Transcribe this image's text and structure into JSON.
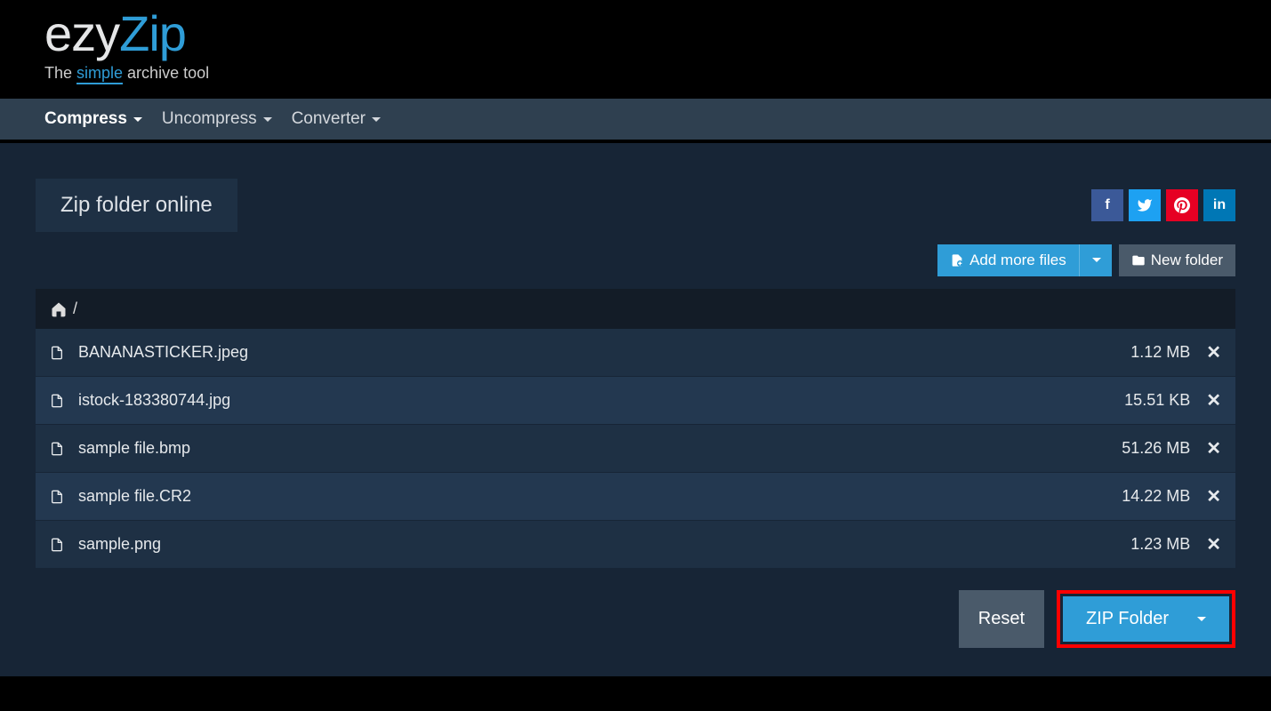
{
  "logo": {
    "part1": "ezy",
    "part2": "Zip"
  },
  "tagline": {
    "pre": "The ",
    "highlight": "simple",
    "post": " archive tool"
  },
  "nav": {
    "compress": "Compress",
    "uncompress": "Uncompress",
    "converter": "Converter"
  },
  "tab": {
    "title": "Zip folder online"
  },
  "actions": {
    "add_more": "Add more files",
    "new_folder": "New folder"
  },
  "breadcrumb": {
    "sep": "/"
  },
  "files": [
    {
      "name": "BANANASTICKER.jpeg",
      "size": "1.12 MB"
    },
    {
      "name": "istock-183380744.jpg",
      "size": "15.51 KB"
    },
    {
      "name": "sample file.bmp",
      "size": "51.26 MB"
    },
    {
      "name": "sample file.CR2",
      "size": "14.22 MB"
    },
    {
      "name": "sample.png",
      "size": "1.23 MB"
    }
  ],
  "footer": {
    "reset": "Reset",
    "zip": "ZIP Folder"
  }
}
